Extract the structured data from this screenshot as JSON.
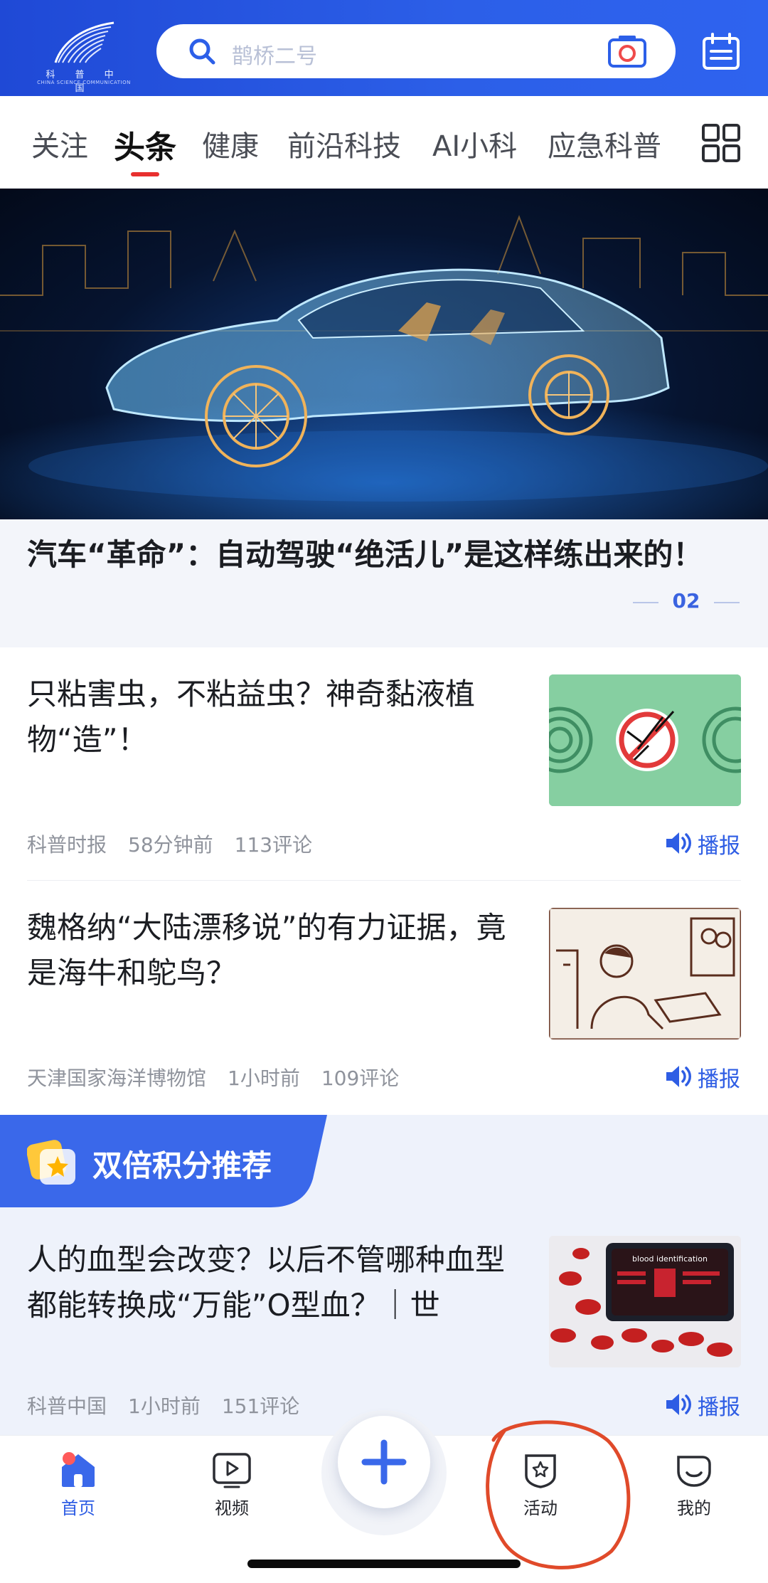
{
  "header": {
    "logo": {
      "text": "科 普 中 国",
      "subtext": "CHINA SCIENCE COMMUNICATION"
    },
    "search": {
      "placeholder": "鹊桥二号"
    },
    "icons": [
      "search-icon",
      "camera-icon",
      "calendar-icon"
    ]
  },
  "tabs": {
    "items": [
      {
        "label": "关注",
        "active": false
      },
      {
        "label": "头条",
        "active": true
      },
      {
        "label": "健康",
        "active": false
      },
      {
        "label": "前沿科技",
        "active": false
      },
      {
        "label": "AI小科",
        "active": false
      },
      {
        "label": "应急科普",
        "active": false
      }
    ],
    "more_icon": "grid-icon"
  },
  "hero": {
    "title": "汽车“革命”：自动驾驶“绝活儿”是这样练出来的！",
    "page": "02"
  },
  "articles": [
    {
      "title": "只粘害虫，不粘益虫？神奇黏液植物“造”！",
      "source": "科普时报",
      "time": "58分钟前",
      "comments": "113评论",
      "play": "播报"
    },
    {
      "title": "魏格纳“大陆漂移说”的有力证据，竟是海牛和鸵鸟？",
      "source": "天津国家海洋博物馆",
      "time": "1小时前",
      "comments": "109评论",
      "play": "播报"
    }
  ],
  "promo": {
    "title": "双倍积分推荐",
    "article": {
      "title": "人的血型会改变？以后不管哪种血型都能转换成“万能”O型血？｜世",
      "source": "科普中国",
      "time": "1小时前",
      "comments": "151评论",
      "play": "播报",
      "thumb_text": "blood identification"
    }
  },
  "bottom_nav": {
    "items": [
      {
        "label": "首页",
        "icon": "home-icon",
        "active": true
      },
      {
        "label": "视频",
        "icon": "video-icon",
        "active": false
      },
      {
        "label": "活动",
        "icon": "activity-badge-icon",
        "active": false
      },
      {
        "label": "我的",
        "icon": "profile-icon",
        "active": false
      }
    ],
    "fab_icon": "plus-icon"
  },
  "colors": {
    "brand_blue": "#2c5fe8",
    "active_tab_underline": "#e8302f",
    "link_blue": "#2e5de4",
    "annotation_red": "#e04a2a"
  }
}
